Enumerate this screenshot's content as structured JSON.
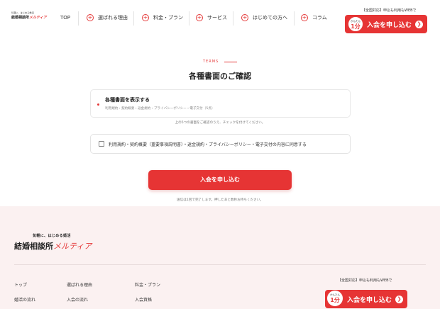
{
  "header": {
    "logo_tagline": "気軽に、はじめる婚活",
    "logo_name": "結婚相談所",
    "logo_accent": "メルティア",
    "nav_top": "TOP",
    "nav": [
      {
        "label": "選ばれる理由"
      },
      {
        "label": "料金・プラン"
      },
      {
        "label": "サービス"
      },
      {
        "label": "はじめての方へ"
      },
      {
        "label": "コラム"
      }
    ],
    "cta_note": "【全国対応】申込も利用もWEBで",
    "cta_badge_top": "かんたん",
    "cta_badge_main": "1分",
    "cta_label": "入会を申し込む"
  },
  "main": {
    "kicker": "TERMS",
    "title": "各種書面のご確認",
    "doc_box_title": "各種書面を表示する",
    "doc_box_list": "利用規約・契約概要・返金規約・プライバシーポリシー・電子交付（5点）",
    "hint": "上の5つの書面をご確認のうえ、チェックを付けてください。",
    "agree_text": "利用規約・契約概要（重要事項説明書）・返金規約・プライバシーポリシー・電子交付の内容に同意する",
    "submit_label": "入会を申し込む",
    "submit_note": "送信は1回で完了します。押したあと数秒お待ちください。"
  },
  "footer": {
    "logo_tagline": "気軽に、はじめる婚活",
    "logo_name": "結婚相談所",
    "logo_accent": "メルティア",
    "links": [
      "トップ",
      "選ばれる理由",
      "料金・プラン",
      "婚活の流れ",
      "入会の流れ",
      "入会資格"
    ],
    "cta_note": "【全国対応】申込も利用もWEBで",
    "cta_badge_top": "かんたん",
    "cta_badge_main": "1分",
    "cta_label": "入会を申し込む"
  },
  "colors": {
    "accent": "#e63434",
    "footer_bg": "#fbf1f1"
  },
  "icons": {
    "nav_plus": "plus-circle-icon",
    "cta_arrow": "arrow-right-icon"
  }
}
